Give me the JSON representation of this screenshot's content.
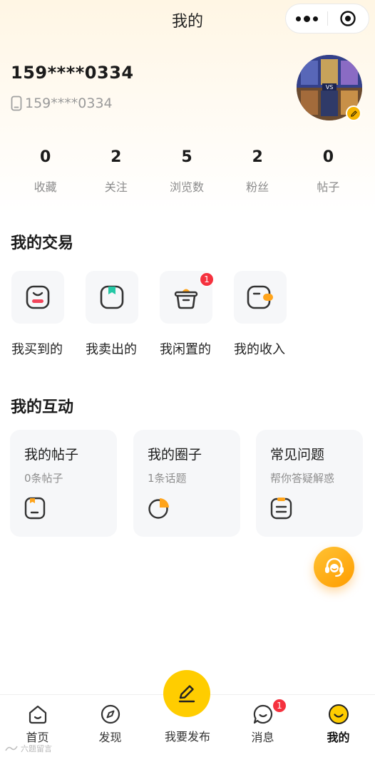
{
  "nav": {
    "title": "我的"
  },
  "profile": {
    "username": "159****0334",
    "phone": "159****0334"
  },
  "stats": [
    {
      "value": "0",
      "label": "收藏"
    },
    {
      "value": "2",
      "label": "关注"
    },
    {
      "value": "5",
      "label": "浏览数"
    },
    {
      "value": "2",
      "label": "粉丝"
    },
    {
      "value": "0",
      "label": "帖子"
    }
  ],
  "trade": {
    "title": "我的交易",
    "items": [
      {
        "label": "我买到的",
        "icon": "bought-bag-icon"
      },
      {
        "label": "我卖出的",
        "icon": "sold-bag-icon"
      },
      {
        "label": "我闲置的",
        "icon": "idle-basket-icon",
        "badge": "1"
      },
      {
        "label": "我的收入",
        "icon": "income-wallet-icon"
      }
    ]
  },
  "interaction": {
    "title": "我的互动",
    "cards": [
      {
        "title": "我的帖子",
        "subtitle": "0条帖子",
        "icon": "post-icon"
      },
      {
        "title": "我的圈子",
        "subtitle": "1条话题",
        "icon": "circle-icon"
      },
      {
        "title": "常见问题",
        "subtitle": "帮你答疑解惑",
        "icon": "faq-icon"
      }
    ]
  },
  "tabbar": {
    "items": [
      {
        "label": "首页",
        "icon": "home-icon"
      },
      {
        "label": "发现",
        "icon": "compass-icon"
      },
      {
        "label": "我要发布",
        "icon": "pencil-icon"
      },
      {
        "label": "消息",
        "icon": "message-icon",
        "badge": "1"
      },
      {
        "label": "我的",
        "icon": "profile-smile-icon"
      }
    ]
  },
  "watermark": "六题留言",
  "colors": {
    "accent": "#ffcd00",
    "badge": "#f5313e",
    "orange": "#ffa41b"
  }
}
